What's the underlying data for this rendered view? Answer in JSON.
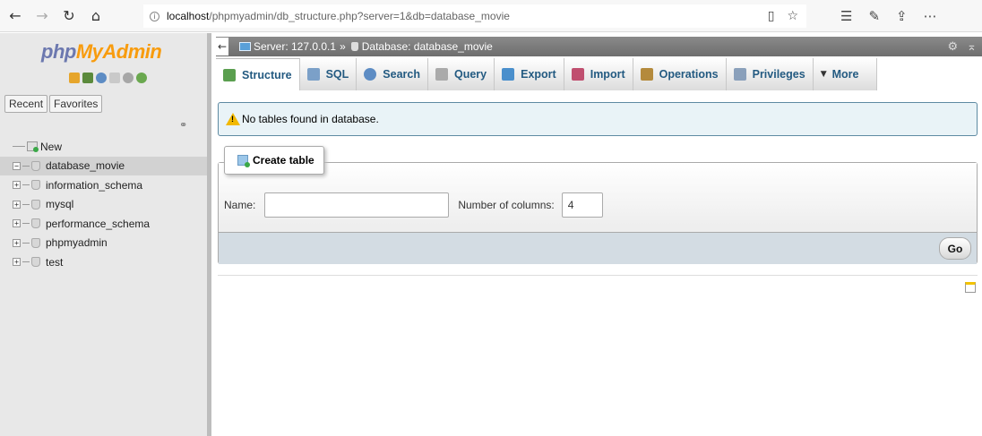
{
  "browser": {
    "back": "←",
    "forward": "→",
    "refresh": "↻",
    "home": "⌂",
    "url_host": "localhost",
    "url_path": "/phpmyadmin/db_structure.php?server=1&db=database_movie"
  },
  "logo": {
    "php": "php",
    "myadmin": "MyAdmin"
  },
  "sidebar": {
    "tabs": [
      "Recent",
      "Favorites"
    ],
    "new_label": "New",
    "databases": [
      {
        "name": "database_movie",
        "expander": "−",
        "active": true
      },
      {
        "name": "information_schema",
        "expander": "+",
        "active": false
      },
      {
        "name": "mysql",
        "expander": "+",
        "active": false
      },
      {
        "name": "performance_schema",
        "expander": "+",
        "active": false
      },
      {
        "name": "phpmyadmin",
        "expander": "+",
        "active": false
      },
      {
        "name": "test",
        "expander": "+",
        "active": false
      }
    ]
  },
  "breadcrumb": {
    "server": "Server: 127.0.0.1",
    "sep": "»",
    "database": "Database: database_movie"
  },
  "menu": [
    {
      "label": "Structure",
      "icon": "structure-icon",
      "color": "#5a9f4f"
    },
    {
      "label": "SQL",
      "icon": "sql-icon",
      "color": "#7ba0c8"
    },
    {
      "label": "Search",
      "icon": "search-icon",
      "color": "#5d8cc4"
    },
    {
      "label": "Query",
      "icon": "query-icon",
      "color": "#aaaaaa"
    },
    {
      "label": "Export",
      "icon": "export-icon",
      "color": "#4a8fcc"
    },
    {
      "label": "Import",
      "icon": "import-icon",
      "color": "#c04f6f"
    },
    {
      "label": "Operations",
      "icon": "operations-icon",
      "color": "#b48a3c"
    },
    {
      "label": "Privileges",
      "icon": "privileges-icon",
      "color": "#8aa0bb"
    },
    {
      "label": "More",
      "icon": "chevron-down-icon",
      "color": "#333333"
    }
  ],
  "notice": {
    "text": "No tables found in database."
  },
  "create_table": {
    "legend": "Create table",
    "name_label": "Name:",
    "name_value": "",
    "columns_label": "Number of columns:",
    "columns_value": "4",
    "go_label": "Go"
  },
  "colors": {
    "link": "#235a81",
    "logo_php": "#6c78af",
    "logo_myadmin": "#f89c0e",
    "server_bar": "#7a7a7a",
    "notice_bg": "#e9f3f7"
  }
}
